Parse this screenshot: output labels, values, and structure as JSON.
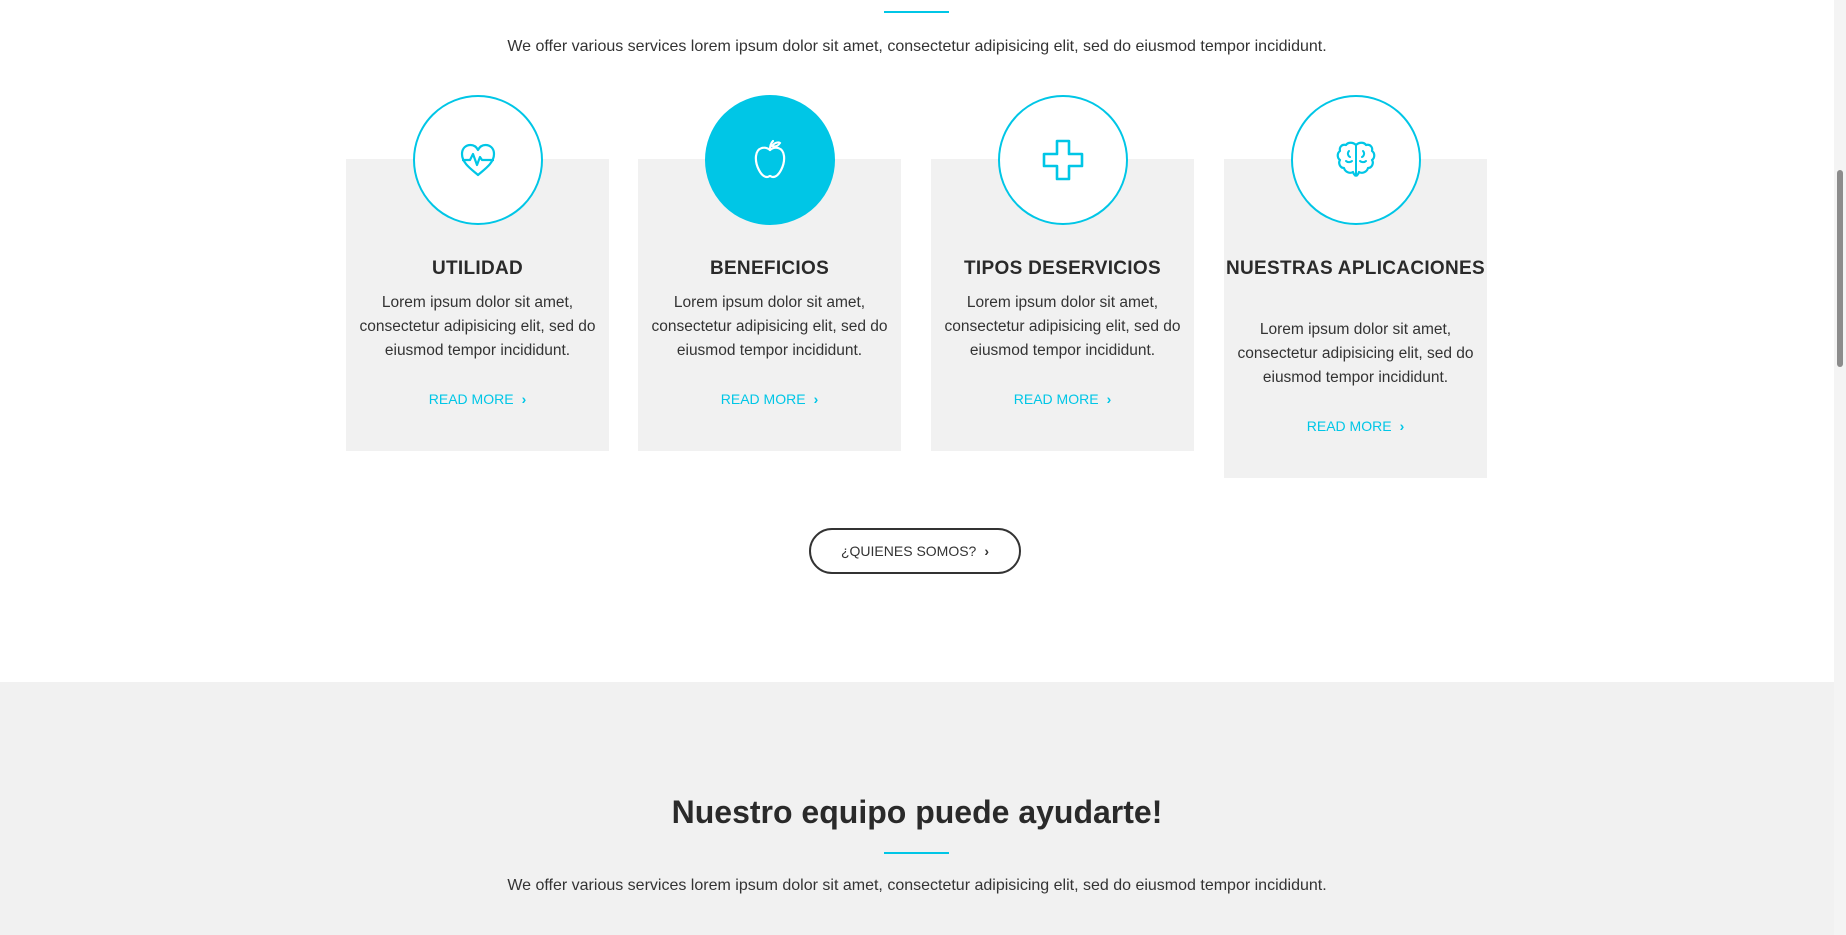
{
  "intro": {
    "text": "We offer various services lorem ipsum dolor sit amet, consectetur adipisicing elit, sed do eiusmod tempor incididunt."
  },
  "cards": [
    {
      "icon": "heart-pulse-icon",
      "title": "UTILIDAD",
      "text": "Lorem ipsum dolor sit amet, consectetur adipisicing elit, sed do eiusmod tempor incididunt.",
      "link": "READ MORE"
    },
    {
      "icon": "apple-icon",
      "title": "BENEFICIOS",
      "text": "Lorem ipsum dolor sit amet, consectetur adipisicing elit, sed do eiusmod tempor incididunt.",
      "link": "READ MORE"
    },
    {
      "icon": "medical-cross-icon",
      "title": "TIPOS DESERVICIOS",
      "text": "Lorem ipsum dolor sit amet, consectetur adipisicing elit, sed do eiusmod tempor incididunt.",
      "link": "READ MORE"
    },
    {
      "icon": "brain-icon",
      "title": "NUESTRAS APLICACIONES",
      "text": "Lorem ipsum dolor sit amet, consectetur adipisicing elit, sed do eiusmod tempor incididunt.",
      "link": "READ MORE"
    }
  ],
  "about_button": {
    "label": "¿QUIENES SOMOS?"
  },
  "team": {
    "title": "Nuestro equipo puede ayudarte!",
    "text": "We offer various services lorem ipsum dolor sit amet, consectetur adipisicing elit, sed do eiusmod tempor incididunt."
  },
  "colors": {
    "accent": "#00c6e6",
    "card_bg": "#f1f1f1",
    "text": "#333333"
  }
}
